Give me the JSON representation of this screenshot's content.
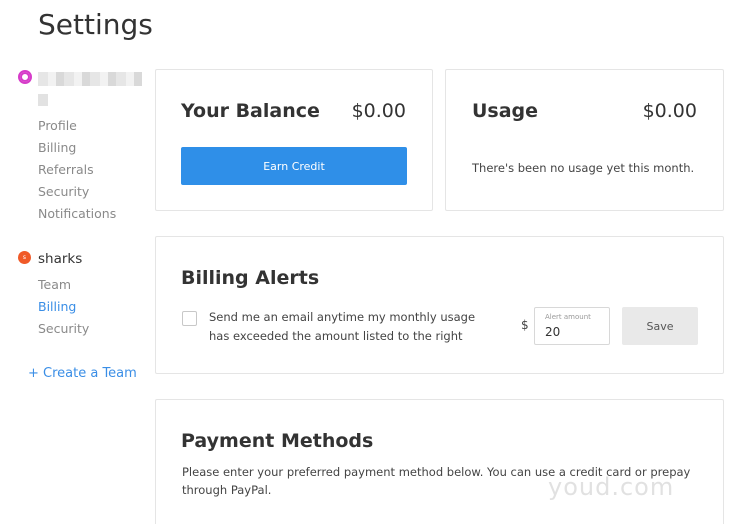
{
  "page": {
    "title": "Settings"
  },
  "sidebar": {
    "user_items": [
      {
        "label": "Profile",
        "active": false
      },
      {
        "label": "Billing",
        "active": false
      },
      {
        "label": "Referrals",
        "active": false
      },
      {
        "label": "Security",
        "active": false
      },
      {
        "label": "Notifications",
        "active": false
      }
    ],
    "team": {
      "name": "sharks",
      "badge": "s",
      "items": [
        {
          "label": "Team",
          "active": false
        },
        {
          "label": "Billing",
          "active": true
        },
        {
          "label": "Security",
          "active": false
        }
      ]
    },
    "create_team_label": "+ Create a Team"
  },
  "balance": {
    "heading": "Your Balance",
    "amount": "$0.00",
    "button_label": "Earn Credit"
  },
  "usage": {
    "heading": "Usage",
    "amount": "$0.00",
    "message": "There's been no usage yet this month."
  },
  "billing_alerts": {
    "heading": "Billing Alerts",
    "checkbox_checked": false,
    "description": "Send me an email anytime my monthly usage has exceeded the amount listed to the right",
    "currency_symbol": "$",
    "field_label": "Alert amount",
    "field_value": "20",
    "save_label": "Save"
  },
  "payment_methods": {
    "heading": "Payment Methods",
    "description": "Please enter your preferred payment method below. You can use a credit card or prepay through PayPal."
  },
  "watermark": "youd.com",
  "colors": {
    "accent": "#2f8fe8",
    "link": "#3a8ee6",
    "team_badge": "#f05a28",
    "user_icon": "#d63cc9"
  },
  "icons": {
    "user_avatar": "user-avatar-icon",
    "team_badge": "team-badge-icon"
  }
}
